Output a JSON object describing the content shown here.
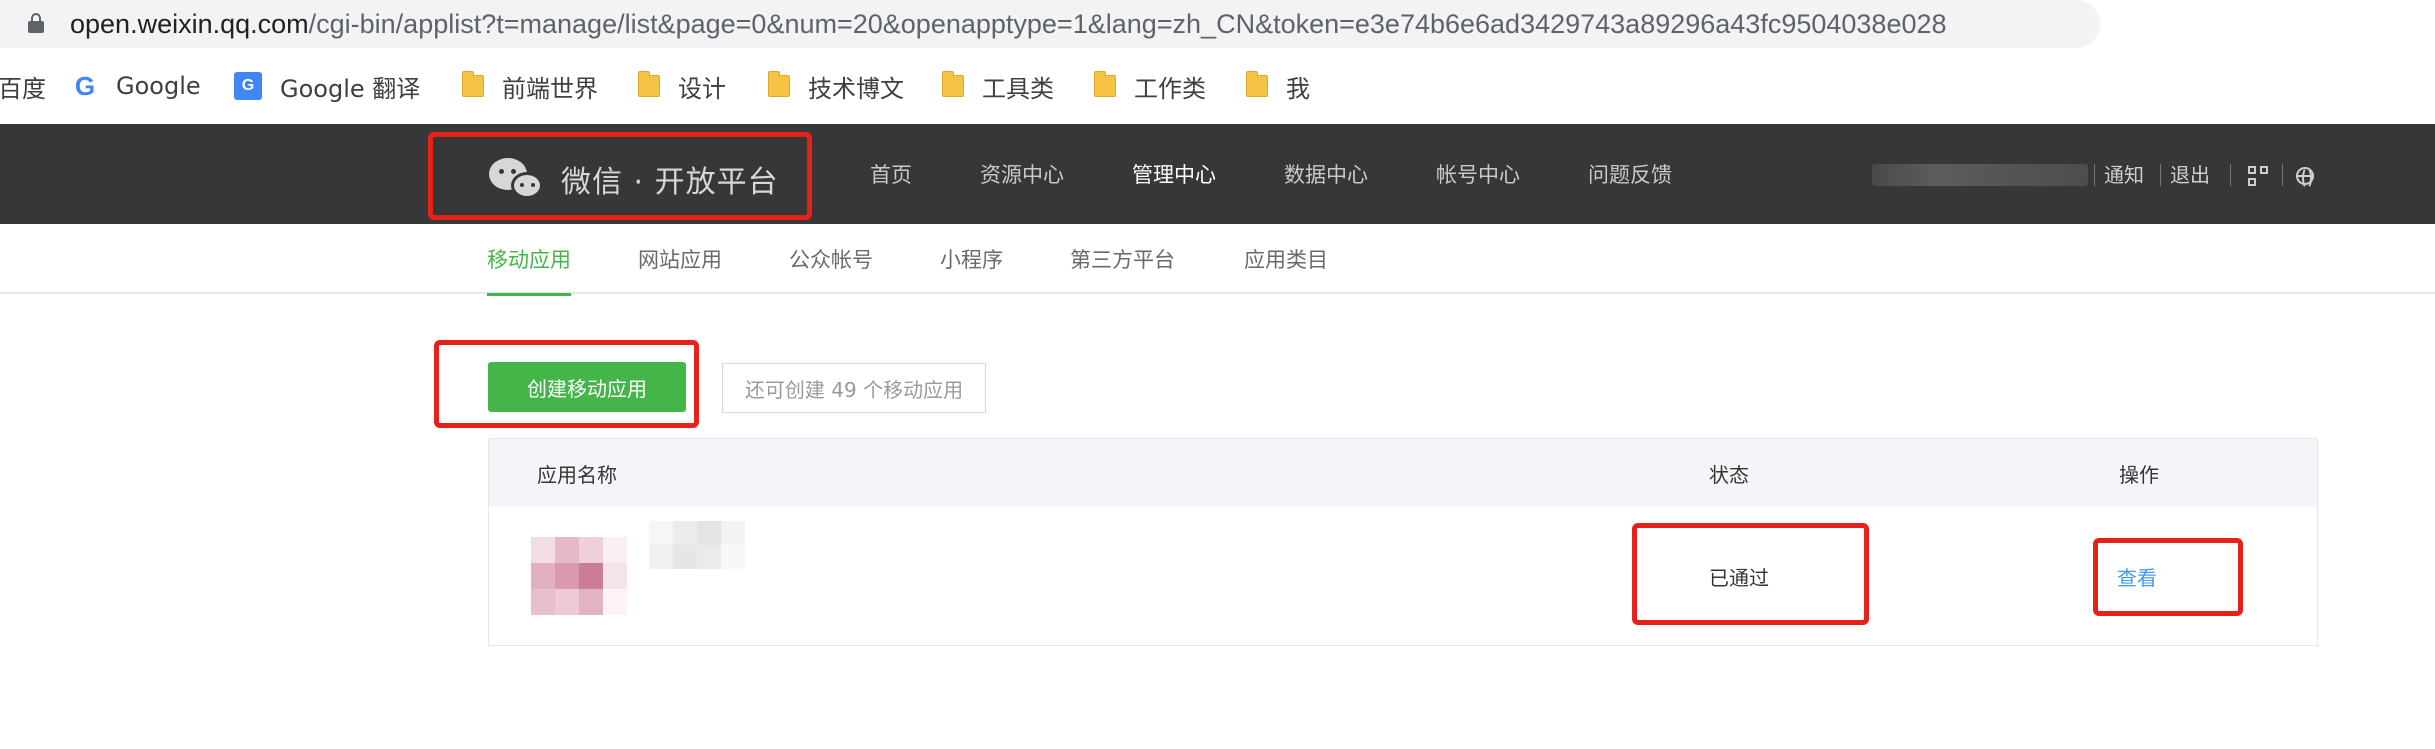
{
  "browser": {
    "url_host": "open.weixin.qq.com",
    "url_path": "/cgi-bin/applist?t=manage/list&page=0&num=20&openapptype=1&lang=zh_CN&token=e3e74b6e6ad3429743a89296a43fc9504038e028"
  },
  "bookmarks": {
    "items": [
      {
        "label": "百度",
        "icon": "partial"
      },
      {
        "label": "Google",
        "icon": "google-icon"
      },
      {
        "label": "Google 翻译",
        "icon": "google-translate-icon"
      },
      {
        "label": "前端世界",
        "icon": "folder-icon"
      },
      {
        "label": "设计",
        "icon": "folder-icon"
      },
      {
        "label": "技术博文",
        "icon": "folder-icon"
      },
      {
        "label": "工具类",
        "icon": "folder-icon"
      },
      {
        "label": "工作类",
        "icon": "folder-icon"
      },
      {
        "label": "我",
        "icon": "folder-icon"
      }
    ]
  },
  "header": {
    "logo_title": "微信 · 开放平台",
    "nav": [
      {
        "label": "首页"
      },
      {
        "label": "资源中心"
      },
      {
        "label": "管理中心",
        "active": true
      },
      {
        "label": "数据中心"
      },
      {
        "label": "帐号中心"
      },
      {
        "label": "问题反馈"
      }
    ],
    "notify": "通知",
    "logout": "退出"
  },
  "subnav": {
    "tabs": [
      {
        "label": "移动应用",
        "active": true
      },
      {
        "label": "网站应用"
      },
      {
        "label": "公众帐号"
      },
      {
        "label": "小程序"
      },
      {
        "label": "第三方平台"
      },
      {
        "label": "应用类目"
      }
    ]
  },
  "main": {
    "create_button": "创建移动应用",
    "remaining_text": "还可创建 49 个移动应用",
    "table": {
      "columns": [
        "应用名称",
        "状态",
        "操作"
      ],
      "rows": [
        {
          "status": "已通过",
          "action": "查看"
        }
      ]
    }
  },
  "colors": {
    "header_bg": "#373737",
    "accent_green": "#44b549",
    "link_blue": "#459ae9",
    "highlight_red": "#e8201a"
  }
}
